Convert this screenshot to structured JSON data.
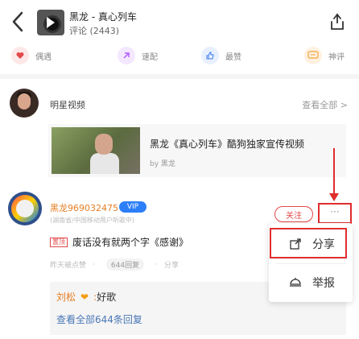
{
  "header": {
    "song_title": "黑龙 - 真心列车",
    "comments_label": "评论 (2443)"
  },
  "reactions": [
    {
      "label": "偶遇",
      "color": "#e24848",
      "icon": "heart-icon"
    },
    {
      "label": "速配",
      "color": "#b35cff",
      "icon": "sparkle-icon"
    },
    {
      "label": "最赞",
      "color": "#3c7be6",
      "icon": "thumb-icon"
    },
    {
      "label": "神评",
      "color": "#f3a23a",
      "icon": "chat-icon"
    }
  ],
  "star_section": {
    "label": "明星视频",
    "view_all": "查看全部 >"
  },
  "video": {
    "title": "黑龙《真心列车》酷狗独家宣传视频",
    "by": "by 黑龙"
  },
  "comment": {
    "username": "黑龙969032475",
    "vip_badge": "VIP",
    "user_sub": "(湖南省/中国移动用户听歌中)",
    "follow_label": "关注",
    "more_label": "···",
    "tag": "置顶",
    "text": "废话没有就两个字《感谢》",
    "time": "昨天被点赞",
    "reply_count": "644回复",
    "share_small": "分享"
  },
  "reply": {
    "name": "刘松",
    "text": "好歌",
    "view_all": "查看全部644条回复"
  },
  "dropdown": {
    "items": [
      "分享",
      "举报"
    ]
  }
}
